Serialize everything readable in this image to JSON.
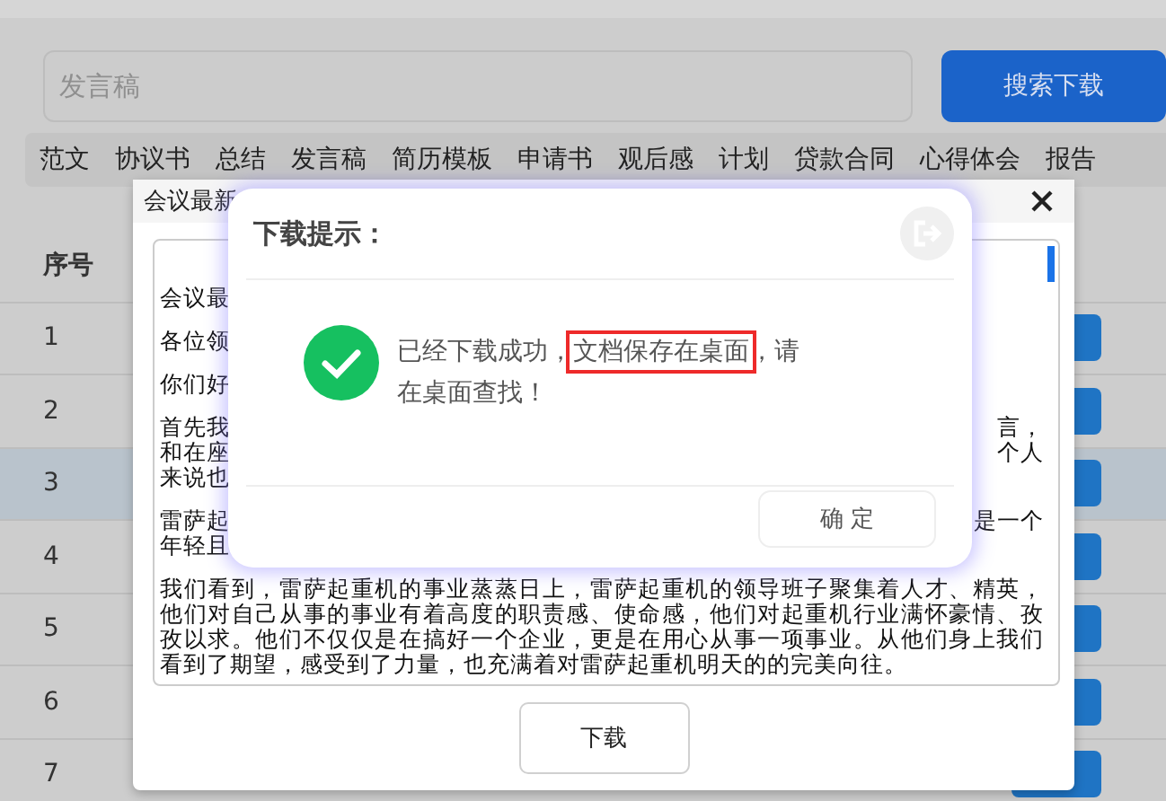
{
  "search": {
    "placeholder": "发言稿",
    "button": "搜索下载"
  },
  "categories": [
    "范文",
    "协议书",
    "总结",
    "发言稿",
    "简历模板",
    "申请书",
    "观后感",
    "计划",
    "贷款合同",
    "心得体会",
    "报告"
  ],
  "table": {
    "columns": [
      "序号"
    ],
    "rows": [
      {
        "number": "1",
        "selected": false
      },
      {
        "number": "2",
        "selected": false
      },
      {
        "number": "3",
        "selected": true
      },
      {
        "number": "4",
        "selected": false
      },
      {
        "number": "5",
        "selected": false
      },
      {
        "number": "6",
        "selected": false
      },
      {
        "number": "7",
        "selected": false
      }
    ]
  },
  "preview": {
    "title": "会议最新",
    "paragraphs": [
      {
        "lines": [
          {
            "left": "会议最"
          }
        ]
      },
      {
        "lines": [
          {
            "left": "各位领"
          }
        ]
      },
      {
        "lines": [
          {
            "left": "你们好"
          }
        ]
      },
      {
        "lines": [
          {
            "left": "首先我",
            "right": "言，"
          },
          {
            "left": "和在座",
            "right": "个人"
          },
          {
            "left": "来说也"
          }
        ]
      },
      {
        "lines": [
          {
            "left": "雷萨起",
            "right": "是一个"
          },
          {
            "left": "年轻且"
          }
        ]
      }
    ],
    "body": "我们看到，雷萨起重机的事业蒸蒸日上，雷萨起重机的领导班子聚集着人才、精英，他们对自己从事的事业有着高度的职责感、使命感，他们对起重机行业满怀豪情、孜孜以求。他们不仅仅是在搞好一个企业，更是在用心从事一项事业。从他们身上我们看到了期望，感受到了力量，也充满着对雷萨起重机明天的的完美向往。",
    "download_button": "下载"
  },
  "alert": {
    "title": "下载提示：",
    "message": [
      {
        "text": "已经下载成功，",
        "highlighted": false
      },
      {
        "text": "文档保存在桌面",
        "highlighted": true
      },
      {
        "text": "，请在桌面查找！",
        "highlighted": false
      }
    ],
    "confirm_button": "确 定"
  }
}
